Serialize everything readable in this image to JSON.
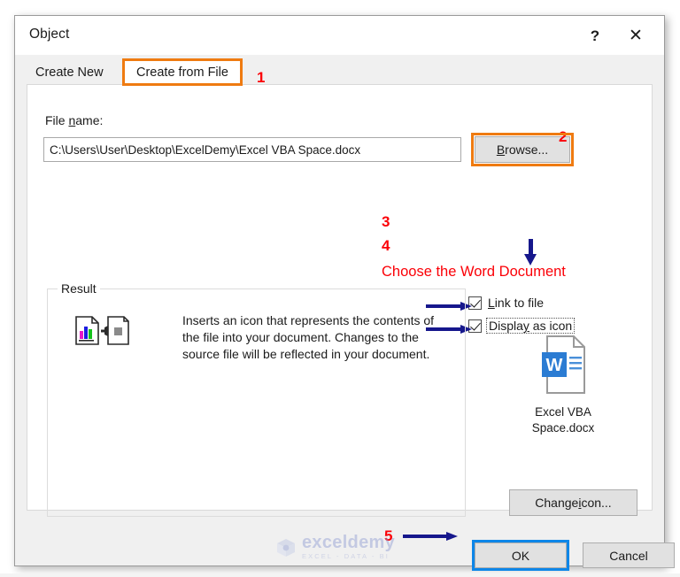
{
  "window": {
    "title": "Object",
    "help_icon": "?",
    "close_icon": "✕"
  },
  "tabs": [
    {
      "label": "Create New",
      "selected": false
    },
    {
      "label": "Create from File",
      "selected": true
    }
  ],
  "form": {
    "file_name_label_pre": "File ",
    "file_name_label_accel": "n",
    "file_name_label_post": "ame:",
    "file_path": "C:\\Users\\User\\Desktop\\ExcelDemy\\Excel VBA Space.docx",
    "browse_label_pre": "",
    "browse_label_accel": "B",
    "browse_label_post": "rowse..."
  },
  "checkboxes": [
    {
      "label_pre": "",
      "label_accel": "L",
      "label_post": "ink to file",
      "checked": true,
      "focused": false
    },
    {
      "label_pre": "Displa",
      "label_accel": "y",
      "label_post": " as icon",
      "checked": true,
      "focused": true
    }
  ],
  "result": {
    "group_title": "Result",
    "description": "Inserts an icon that represents the contents of the file into your document. Changes to the source file will be reflected in your document."
  },
  "preview": {
    "icon": "word-document-icon",
    "file_name_line1": "Excel VBA",
    "file_name_line2": "Space.docx"
  },
  "buttons": {
    "change_icon_pre": "Change ",
    "change_icon_accel": "i",
    "change_icon_post": "con...",
    "ok": "OK",
    "cancel": "Cancel"
  },
  "annotations": {
    "note": "Choose the Word Document",
    "numbers": [
      "1",
      "2",
      "3",
      "4",
      "5"
    ],
    "red_color": "#fb0007",
    "orange_color": "#ef7b11",
    "arrow_color": "#16178c",
    "focus_color": "#0d86e8"
  },
  "watermark": {
    "name": "exceldemy",
    "tagline": "EXCEL - DATA - BI"
  }
}
